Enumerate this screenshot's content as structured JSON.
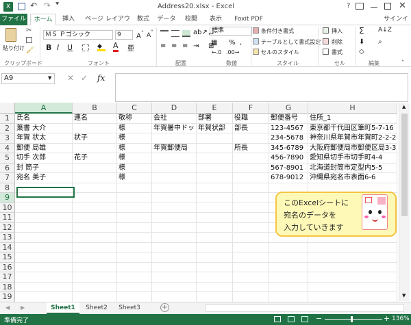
{
  "title": {
    "text": "Address20.xlsx - Excel",
    "help": "?"
  },
  "tabs": [
    "ファイル",
    "ホーム",
    "挿入",
    "ページ レイアウト",
    "数式",
    "データ",
    "校閲",
    "表示",
    "Foxit PDF"
  ],
  "signin": "サインイン",
  "ribbon": {
    "paste": "貼り付け",
    "clipboard": "クリップボード",
    "font_name": "ＭＳ Ｐゴシック",
    "font_size": "9",
    "font_group": "フォント",
    "align_group": "配置",
    "number_format": "標準",
    "number_group": "数値",
    "cond_format": "条件付き書式",
    "table_format": "テーブルとして書式設定",
    "cell_style": "セルのスタイル",
    "style_group": "スタイル",
    "insert": "挿入",
    "delete": "削除",
    "format": "書式",
    "cells_group": "セル",
    "edit_group": "編集"
  },
  "formula": {
    "namebox": "A9",
    "fx": "fx",
    "value": ""
  },
  "columns": [
    "A",
    "B",
    "C",
    "D",
    "E",
    "F",
    "G",
    "H"
  ],
  "rows": [
    "1",
    "2",
    "3",
    "4",
    "5",
    "6",
    "7",
    "8",
    "9",
    "10",
    "11",
    "12",
    "13",
    "14",
    "15",
    "16",
    "17",
    "18",
    "19"
  ],
  "cells": [
    [
      "氏名",
      "連名",
      "敬称",
      "会社",
      "部署",
      "役職",
      "郵便番号",
      "住所_1"
    ],
    [
      "葉書 大介",
      "",
      "様",
      "年賀暑中ドット",
      "年賀状部",
      "部長",
      "123-4567",
      "東京都千代田区筆町5-7-16"
    ],
    [
      "年賀 状太",
      "状子",
      "様",
      "",
      "",
      "",
      "234-5678",
      "神奈川県年賀市年賀町2-2-2"
    ],
    [
      "郵便 局雄",
      "",
      "様",
      "年賀郵便局",
      "",
      "所長",
      "345-6789",
      "大阪府郵便局市郵便区局3-3"
    ],
    [
      "切手 次郎",
      "花子",
      "様",
      "",
      "",
      "",
      "456-7890",
      "愛知県切手市切手町4-4"
    ],
    [
      "封 筒子",
      "",
      "様",
      "",
      "",
      "",
      "567-8901",
      "北海道封筒市定型内5-5"
    ],
    [
      "宛名 美子",
      "",
      "様",
      "",
      "",
      "",
      "678-9012",
      "沖縄県宛名市表面6-6"
    ]
  ],
  "callout": [
    "このExcelシートに",
    "宛名のデータを",
    "入力していきます"
  ],
  "sheets": [
    "Sheet1",
    "Sheet2",
    "Sheet3"
  ],
  "status": {
    "ready": "準備完了",
    "zoom": "136%"
  },
  "colors": {
    "accent": "#217346"
  }
}
